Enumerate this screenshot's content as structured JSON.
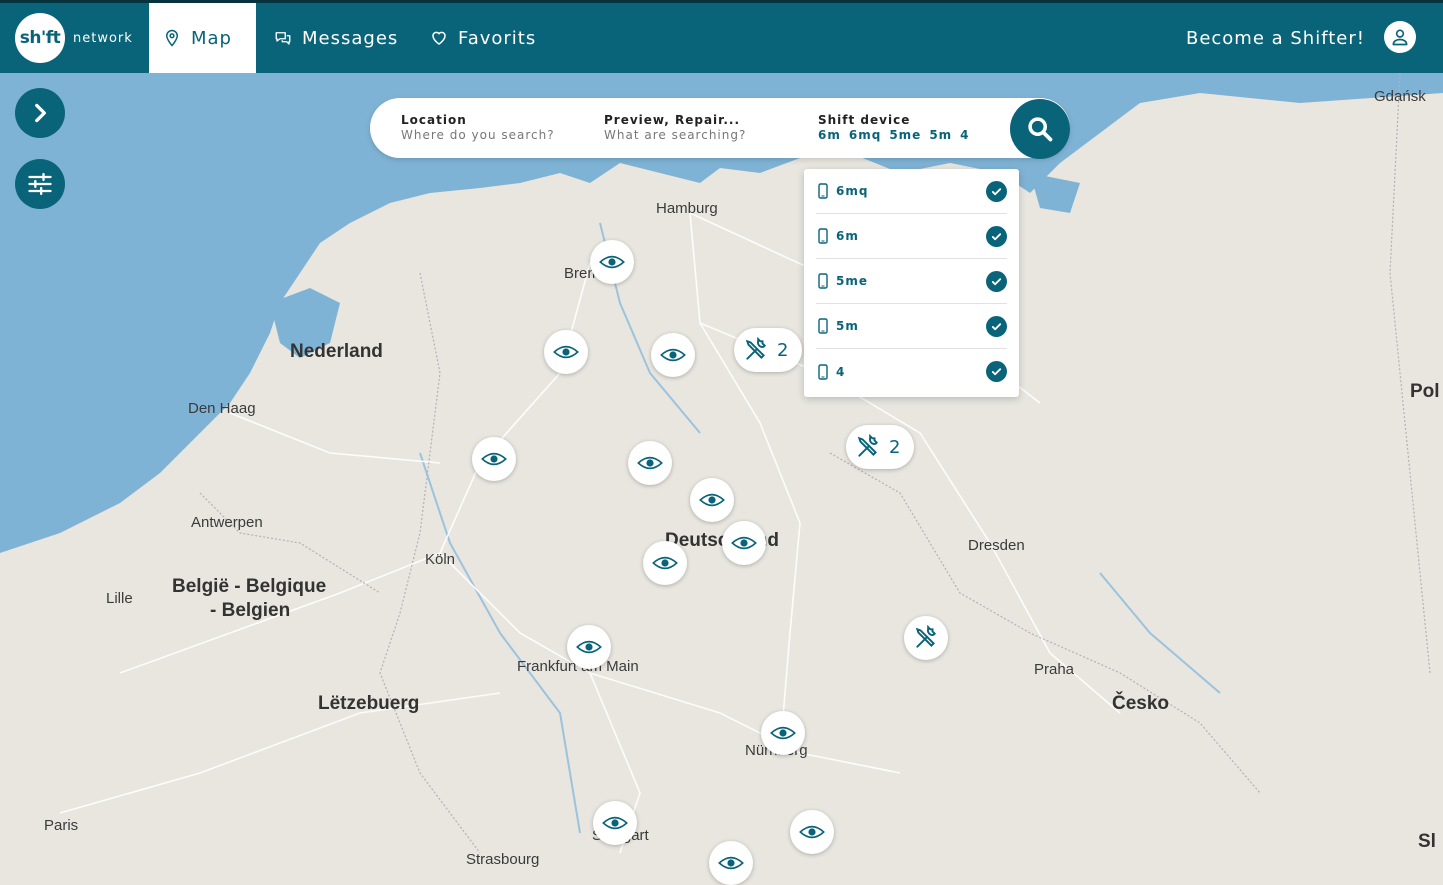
{
  "brand": {
    "logo_text": "sh'ft",
    "network_label": "network"
  },
  "nav": {
    "map": "Map",
    "messages": "Messages",
    "favorites": "Favorits",
    "become_shifter": "Become a Shifter!"
  },
  "search": {
    "location": {
      "label": "Location",
      "placeholder": "Where do you search?"
    },
    "service": {
      "label": "Preview, Repair...",
      "placeholder": "What are searching?"
    },
    "device": {
      "label": "Shift device",
      "tags": [
        "6m",
        "6mq",
        "5me",
        "5m",
        "4"
      ]
    }
  },
  "device_dropdown": [
    {
      "label": "6mq",
      "checked": true
    },
    {
      "label": "6m",
      "checked": true
    },
    {
      "label": "5me",
      "checked": true
    },
    {
      "label": "5m",
      "checked": true
    },
    {
      "label": "4",
      "checked": true
    }
  ],
  "map_labels": {
    "gdansk": "Gdańsk",
    "hamburg": "Hamburg",
    "bremen": "Bremen",
    "nederland": "Nederland",
    "den_haag": "Den Haag",
    "antwerpen": "Antwerpen",
    "koln": "Köln",
    "belgie_line1": "België - Belgique",
    "belgie_line2": "- Belgien",
    "lille": "Lille",
    "deutschland": "Deutschland",
    "dresden": "Dresden",
    "frankfurt": "Frankfurt am Main",
    "letzebuerg": "Lëtzebuerg",
    "praha": "Praha",
    "cesko": "Česko",
    "nurnberg": "Nürnberg",
    "paris": "Paris",
    "stuttgart": "Stuttgart",
    "strasbourg": "Strasbourg",
    "polska_partial": "Pol",
    "slovensko_partial": "Sl"
  },
  "cluster_counts": {
    "repair_cluster_a": "2",
    "repair_cluster_b": "2"
  },
  "colors": {
    "brand": "#0a6479",
    "water": "#7fb3d5",
    "land": "#e8e6df"
  }
}
